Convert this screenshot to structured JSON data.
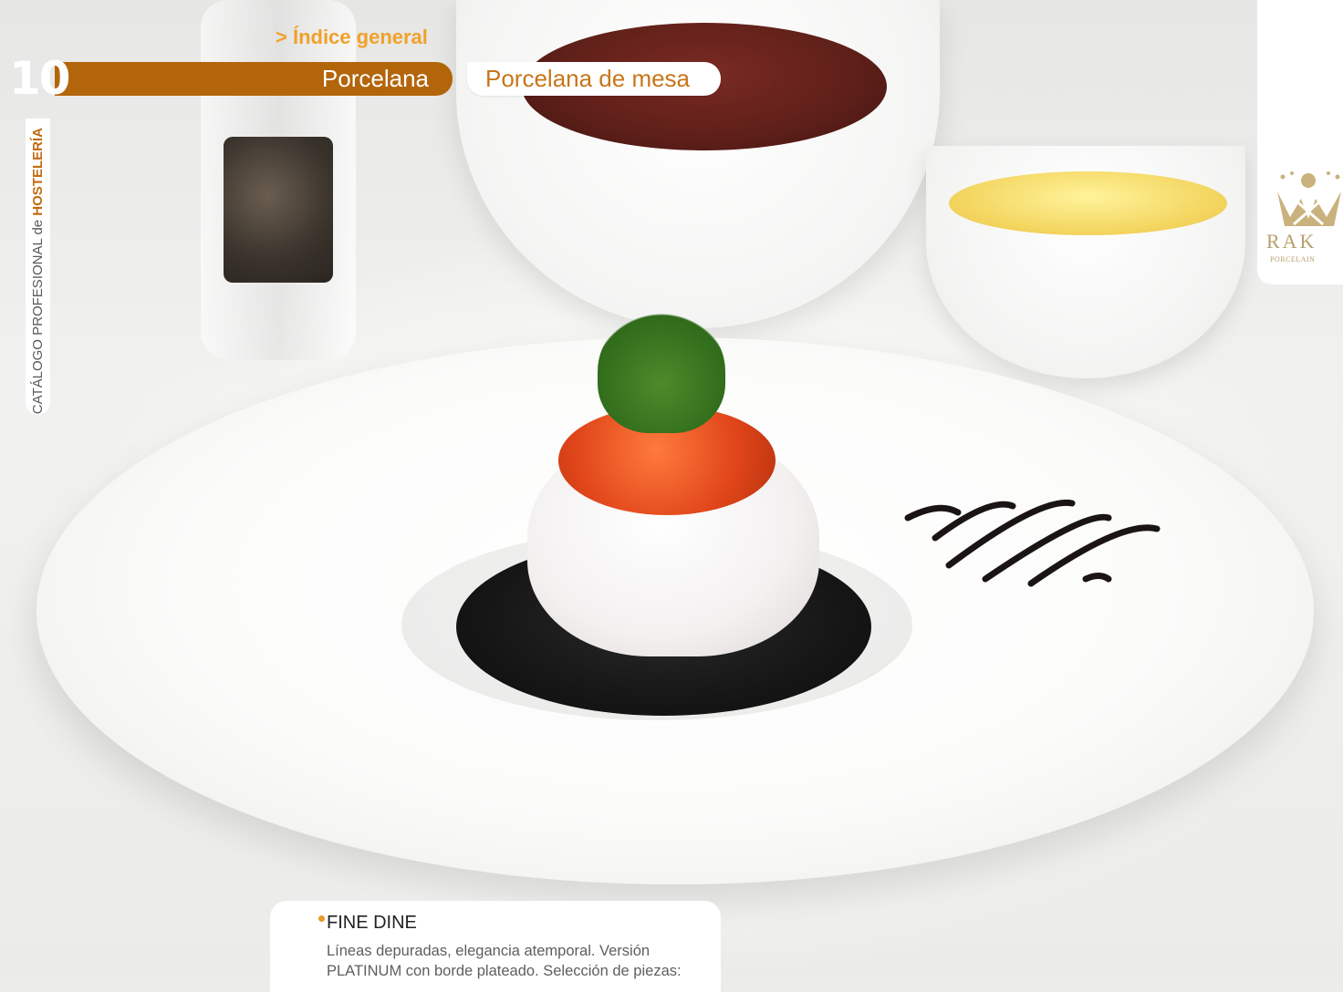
{
  "header": {
    "index_link": "> Índice general",
    "page_number": "10",
    "section": "Porcelana",
    "subsection": "Porcelana de mesa"
  },
  "sidebar": {
    "catalog_text": "CATÁLOGO PROFESIONAL de",
    "catalog_highlight": "HOSTELERÍA"
  },
  "brand": {
    "name": "RAK",
    "subtitle": "PORCELAIN"
  },
  "product": {
    "title": "FINE DINE",
    "description_line_1": "Líneas depuradas, elegancia atemporal. Versión",
    "description_line_2": "PLATINUM con borde plateado. Selección de piezas:"
  },
  "colors": {
    "accent_band": "#b3650a",
    "accent_text": "#c7761a",
    "link": "#f0a12a"
  }
}
